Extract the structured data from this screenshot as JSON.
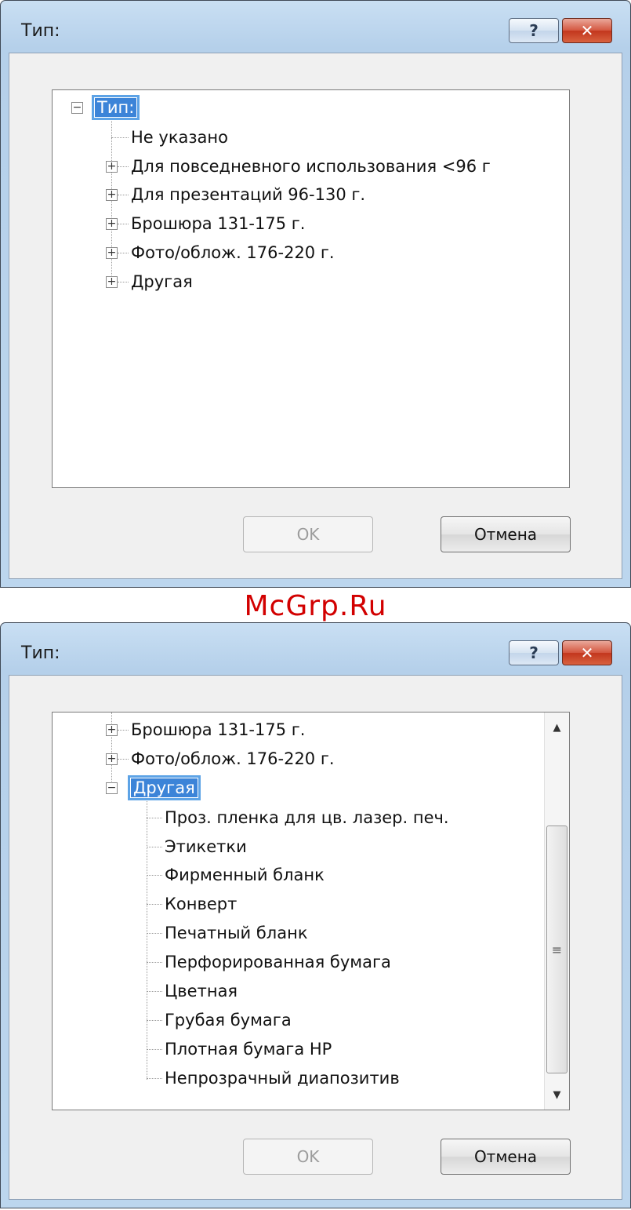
{
  "dialog1": {
    "title": "Тип:",
    "help_label": "?",
    "close_label": "✕",
    "tree": {
      "root": "Тип:",
      "items": [
        "Не указано",
        "Для повседневного использования <96 г",
        "Для презентаций 96-130 г.",
        "Брошюра 131-175 г.",
        "Фото/облож. 176-220 г.",
        "Другая"
      ]
    },
    "ok_label": "OK",
    "cancel_label": "Отмена"
  },
  "watermark": "McGrp.Ru",
  "dialog2": {
    "title": "Тип:",
    "help_label": "?",
    "close_label": "✕",
    "tree": {
      "parents": [
        "Брошюра 131-175 г.",
        "Фото/облож. 176-220 г."
      ],
      "expanded": "Другая",
      "children": [
        "Проз. пленка для цв. лазер. печ.",
        "Этикетки",
        "Фирменный бланк",
        "Конверт",
        "Печатный бланк",
        "Перфорированная бумага",
        "Цветная",
        "Грубая бумага",
        "Плотная бумага HP",
        "Непрозрачный диапозитив"
      ]
    },
    "ok_label": "OK",
    "cancel_label": "Отмена"
  },
  "icons": {
    "expand": "plus-box-icon",
    "collapse": "minus-box-icon"
  }
}
